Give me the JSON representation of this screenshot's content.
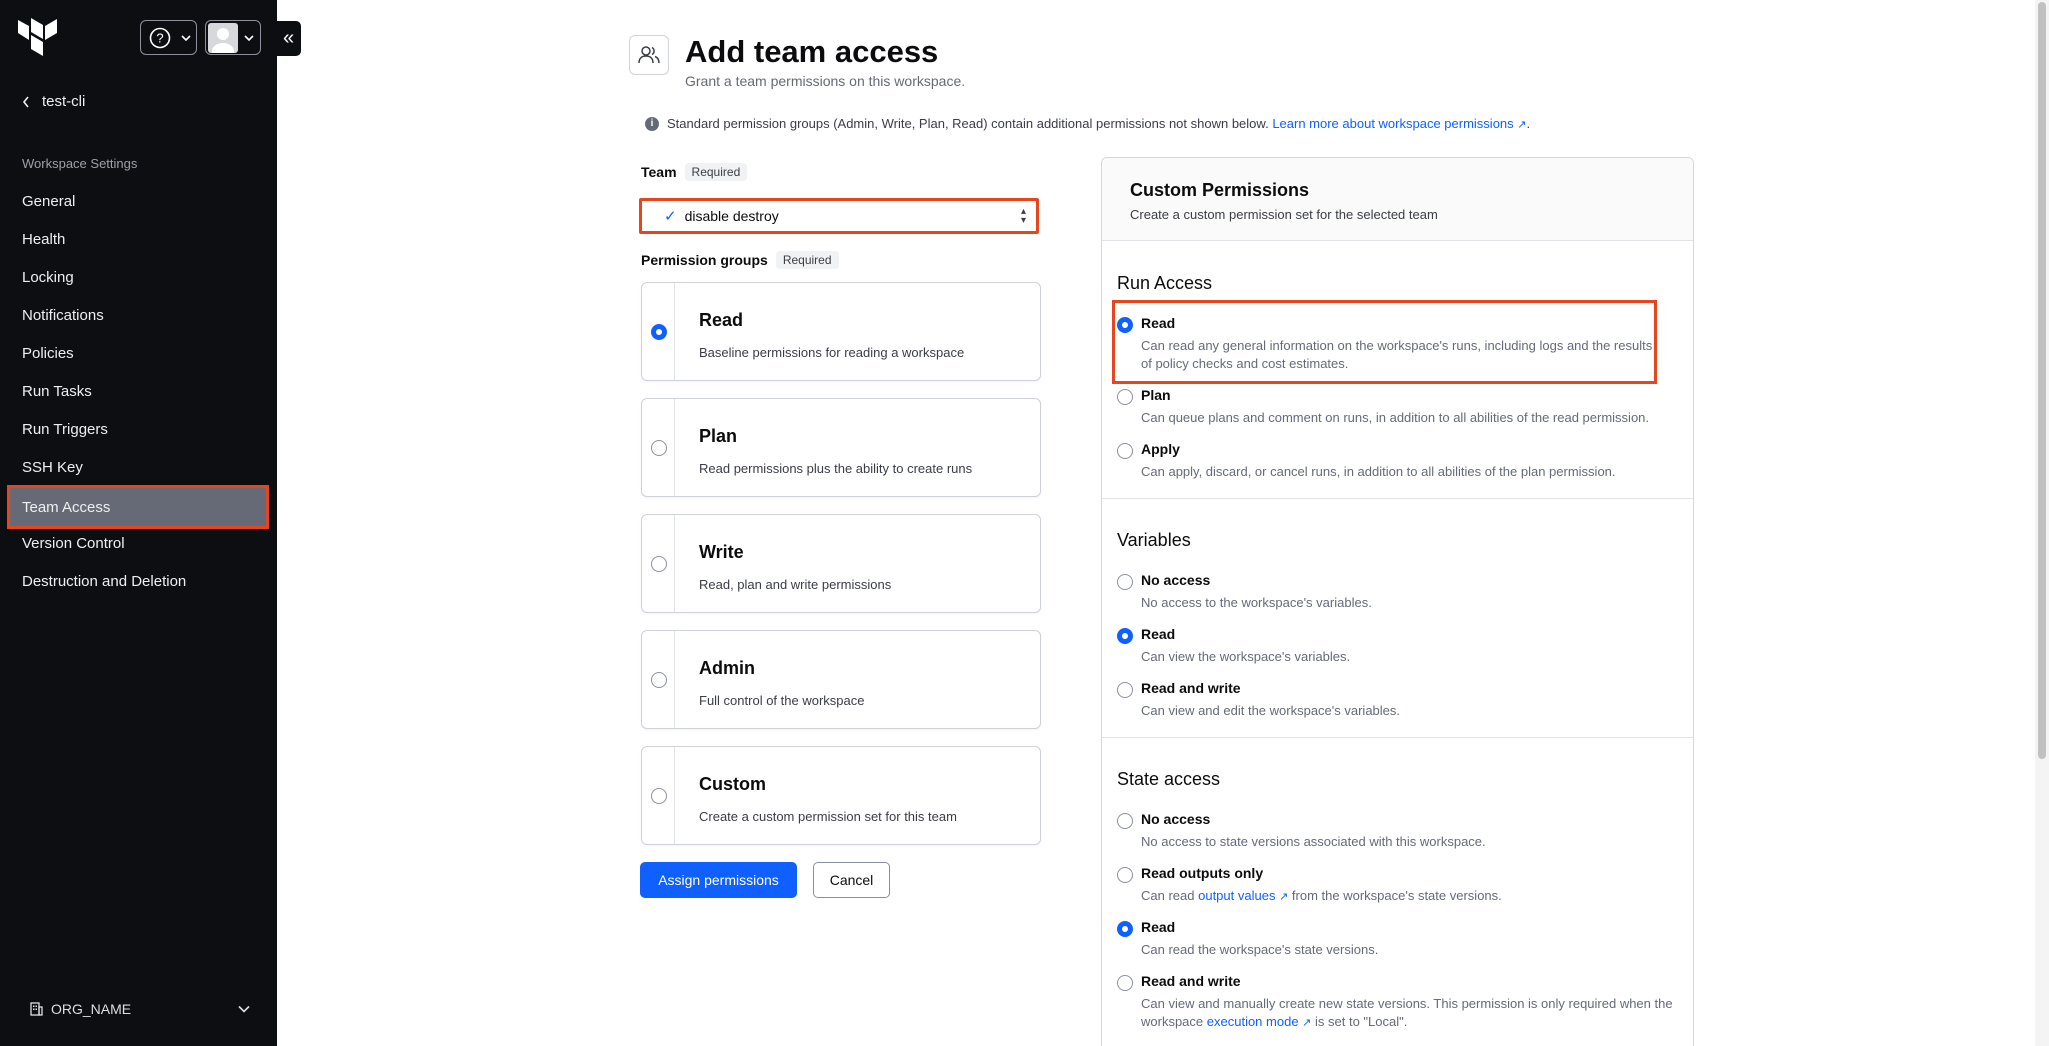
{
  "sidebar": {
    "back_label": "test-cli",
    "section_title": "Workspace Settings",
    "items": [
      {
        "label": "General"
      },
      {
        "label": "Health"
      },
      {
        "label": "Locking"
      },
      {
        "label": "Notifications"
      },
      {
        "label": "Policies"
      },
      {
        "label": "Run Tasks"
      },
      {
        "label": "Run Triggers"
      },
      {
        "label": "SSH Key"
      },
      {
        "label": "Team Access",
        "active": true
      },
      {
        "label": "Version Control"
      },
      {
        "label": "Destruction and Deletion"
      }
    ],
    "org_name": "ORG_NAME"
  },
  "header": {
    "title": "Add team access",
    "subtitle": "Grant a team permissions on this workspace."
  },
  "info": {
    "text": "Standard permission groups (Admin, Write, Plan, Read) contain additional permissions not shown below.",
    "link": "Learn more about workspace permissions",
    "period": "."
  },
  "team": {
    "label": "Team",
    "required": "Required",
    "selected": "disable destroy"
  },
  "permission_groups": {
    "label": "Permission groups",
    "required": "Required",
    "options": [
      {
        "title": "Read",
        "desc": "Baseline permissions for reading a workspace",
        "selected": true
      },
      {
        "title": "Plan",
        "desc": "Read permissions plus the ability to create runs"
      },
      {
        "title": "Write",
        "desc": "Read, plan and write permissions"
      },
      {
        "title": "Admin",
        "desc": "Full control of the workspace"
      },
      {
        "title": "Custom",
        "desc": "Create a custom permission set for this team"
      }
    ]
  },
  "actions": {
    "assign": "Assign permissions",
    "cancel": "Cancel"
  },
  "custom": {
    "title": "Custom Permissions",
    "subtitle": "Create a custom permission set for the selected team",
    "run_access": {
      "title": "Run Access",
      "options": [
        {
          "title": "Read",
          "desc": "Can read any general information on the workspace's runs, including logs and the results of policy checks and cost estimates.",
          "selected": true
        },
        {
          "title": "Plan",
          "desc": "Can queue plans and comment on runs, in addition to all abilities of the read permission."
        },
        {
          "title": "Apply",
          "desc": "Can apply, discard, or cancel runs, in addition to all abilities of the plan permission."
        }
      ]
    },
    "variables": {
      "title": "Variables",
      "options": [
        {
          "title": "No access",
          "desc": "No access to the workspace's variables."
        },
        {
          "title": "Read",
          "desc": "Can view the workspace's variables.",
          "selected": true
        },
        {
          "title": "Read and write",
          "desc": "Can view and edit the workspace's variables."
        }
      ]
    },
    "state_access": {
      "title": "State access",
      "options": [
        {
          "title": "No access",
          "desc": "No access to state versions associated with this workspace."
        },
        {
          "title": "Read outputs only",
          "desc_pre": "Can read",
          "desc_link": "output values",
          "desc_post": "from the workspace's state versions."
        },
        {
          "title": "Read",
          "desc": "Can read the workspace's state versions.",
          "selected": true
        },
        {
          "title": "Read and write",
          "desc_pre": "Can view and manually create new state versions. This permission is only required when the workspace",
          "desc_link": "execution mode",
          "desc_post": "is set to \"Local\"."
        }
      ]
    }
  },
  "colors": {
    "sidebar_bg": "#0d0e12",
    "active_item_bg": "#656a76",
    "highlight": "#e5461d",
    "primary": "#1060ff"
  }
}
